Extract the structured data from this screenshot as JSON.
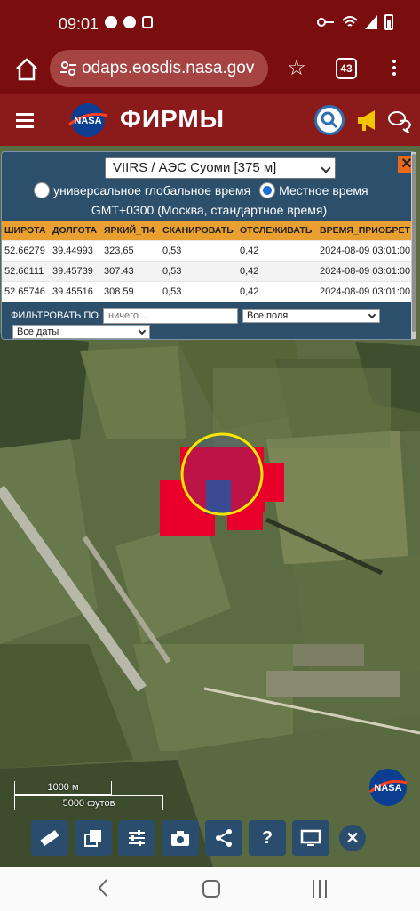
{
  "status_bar": {
    "time": "09:01"
  },
  "browser": {
    "url": "odaps.eosdis.nasa.gov",
    "tab_count": "43"
  },
  "header": {
    "logo_text": "NASA",
    "title": "ФИРМЫ"
  },
  "panel": {
    "sensor": "VIIRS / АЭС Суоми [375 м]",
    "close_label": "✕",
    "tz_utc_label": "универсальное глобальное время",
    "tz_local_label": "Местное время",
    "tz_selected": "local",
    "tz_offset": "GMT+0300 (Москва, стандартное время)",
    "columns": [
      "ШИРОТА",
      "ДОЛГОТА",
      "ЯРКИЙ_TI4",
      "СКАНИРОВАТЬ",
      "ОТСЛЕЖИВАТЬ",
      "ВРЕМЯ_ПРИОБРЕТ"
    ],
    "rows": [
      [
        "52.66279",
        "39.44993",
        "323,65",
        "0,53",
        "0,42",
        "2024-08-09 03:01:00"
      ],
      [
        "52.66111",
        "39.45739",
        "307.43",
        "0,53",
        "0,42",
        "2024-08-09 03:01:00"
      ],
      [
        "52.65746",
        "39.45516",
        "308.59",
        "0,53",
        "0,42",
        "2024-08-09 03:01:00"
      ]
    ],
    "filter_label": "ФИЛЬТРОВАТЬ ПО",
    "filter_placeholder": "ничего ...",
    "fields_value": "Все поля",
    "dates_value": "Все даты"
  },
  "map": {
    "scale_km": "1000 м",
    "scale_ft": "5000 футов",
    "fire_color": "#e8002a",
    "highlight_color": "#ffe600"
  },
  "toolbar": {
    "items": [
      "ruler-icon",
      "layers-icon",
      "settings-sliders-icon",
      "camera-icon",
      "share-icon",
      "help-icon",
      "monitor-icon"
    ],
    "help_label": "?",
    "close_label": "✕"
  }
}
